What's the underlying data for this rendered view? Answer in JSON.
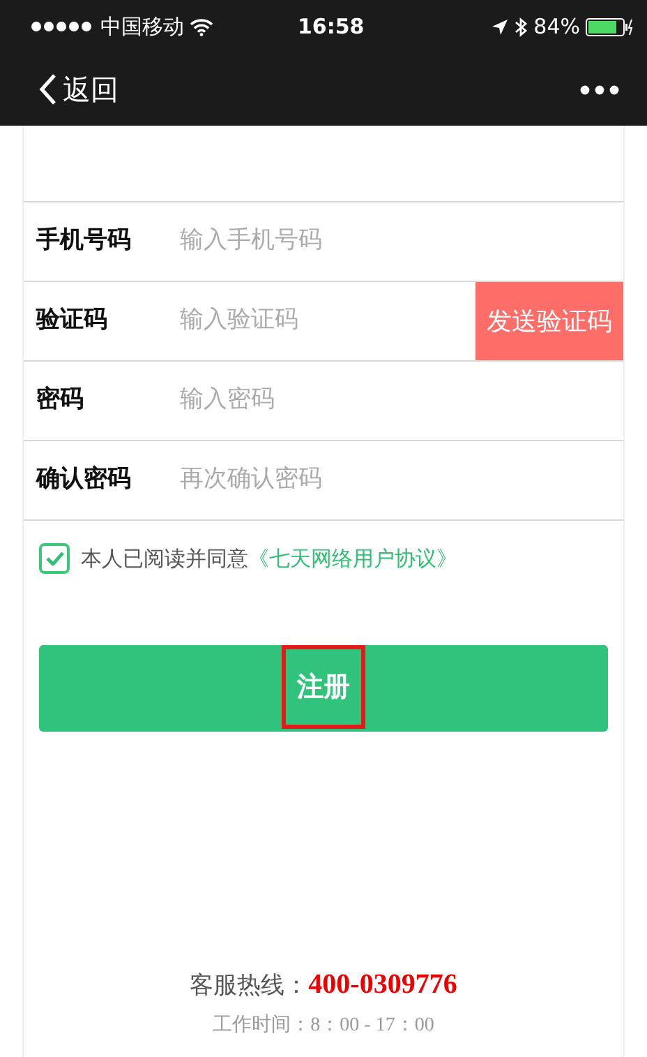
{
  "status_bar": {
    "carrier": "中国移动",
    "time": "16:58",
    "battery": "84%"
  },
  "nav": {
    "back": "返回"
  },
  "fields": [
    {
      "label": "手机号码",
      "placeholder": "输入手机号码"
    },
    {
      "label": "验证码",
      "placeholder": "输入验证码",
      "button": "发送验证码"
    },
    {
      "label": "密码",
      "placeholder": "输入密码"
    },
    {
      "label": "确认密码",
      "placeholder": "再次确认密码"
    }
  ],
  "agreement": {
    "checked": true,
    "text": "本人已阅读并同意",
    "link": "《七天网络用户协议》"
  },
  "register": {
    "label": "注册",
    "highlighted": true
  },
  "footer": {
    "hotline_label": "客服热线：",
    "hotline": "400-0309776",
    "hours": "工作时间：8：00 - 17：00"
  }
}
